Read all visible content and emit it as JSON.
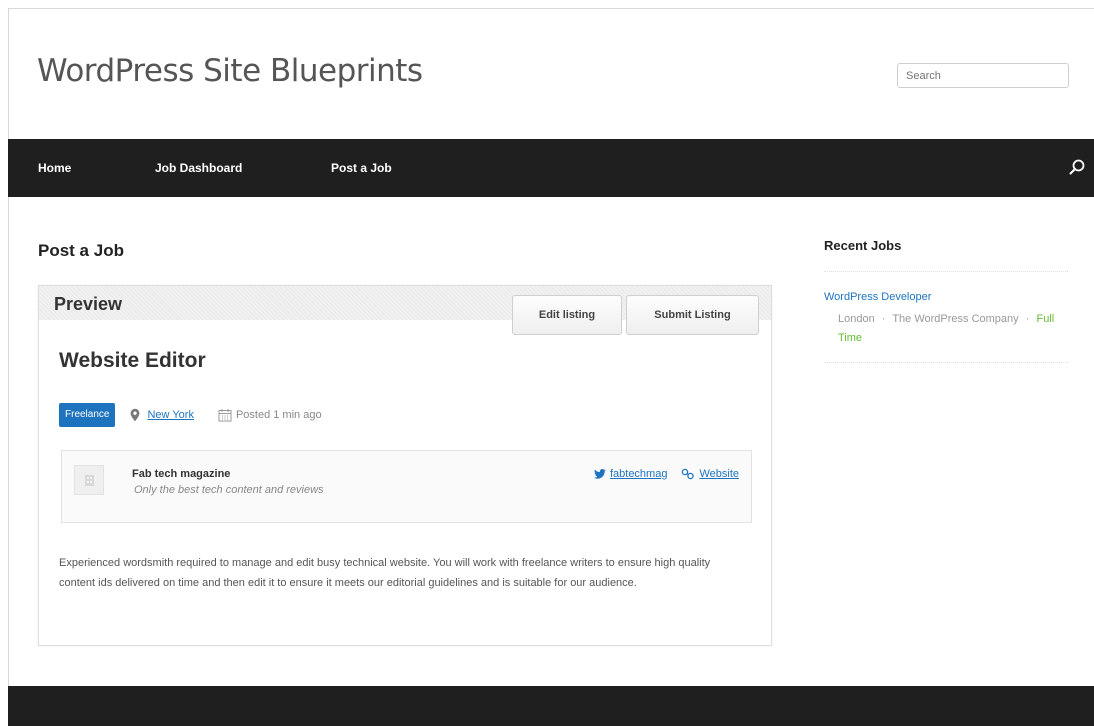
{
  "site": {
    "title": "WordPress Site Blueprints",
    "search_placeholder": "Search"
  },
  "nav": {
    "items": [
      "Home",
      "Job Dashboard",
      "Post a Job"
    ]
  },
  "page": {
    "title": "Post a Job"
  },
  "preview": {
    "label": "Preview",
    "edit_button": "Edit listing",
    "submit_button": "Submit Listing"
  },
  "job": {
    "title": "Website Editor",
    "type": "Freelance",
    "location": "New York",
    "posted": "Posted 1 min ago",
    "company": {
      "name": "Fab tech magazine",
      "tagline": "Only the best tech content and reviews",
      "twitter": "fabtechmag",
      "website": "Website"
    },
    "description": "Experienced wordsmith required to manage and edit busy technical website. You will work with freelance writers to ensure high quality content ids delivered on time and then edit it to ensure it meets our editorial guidelines and is suitable for our audience."
  },
  "sidebar": {
    "widget_title": "Recent Jobs",
    "jobs": [
      {
        "title": "WordPress Developer",
        "location": "London",
        "company": "The WordPress Company",
        "type": "Full Time"
      }
    ]
  },
  "colors": {
    "accent": "#1e73be",
    "nav_bg": "#1f1f1f",
    "full_time": "#66bb33"
  },
  "icons": [
    "search-icon",
    "map-marker-icon",
    "calendar-icon",
    "building-icon",
    "twitter-icon",
    "link-icon"
  ]
}
